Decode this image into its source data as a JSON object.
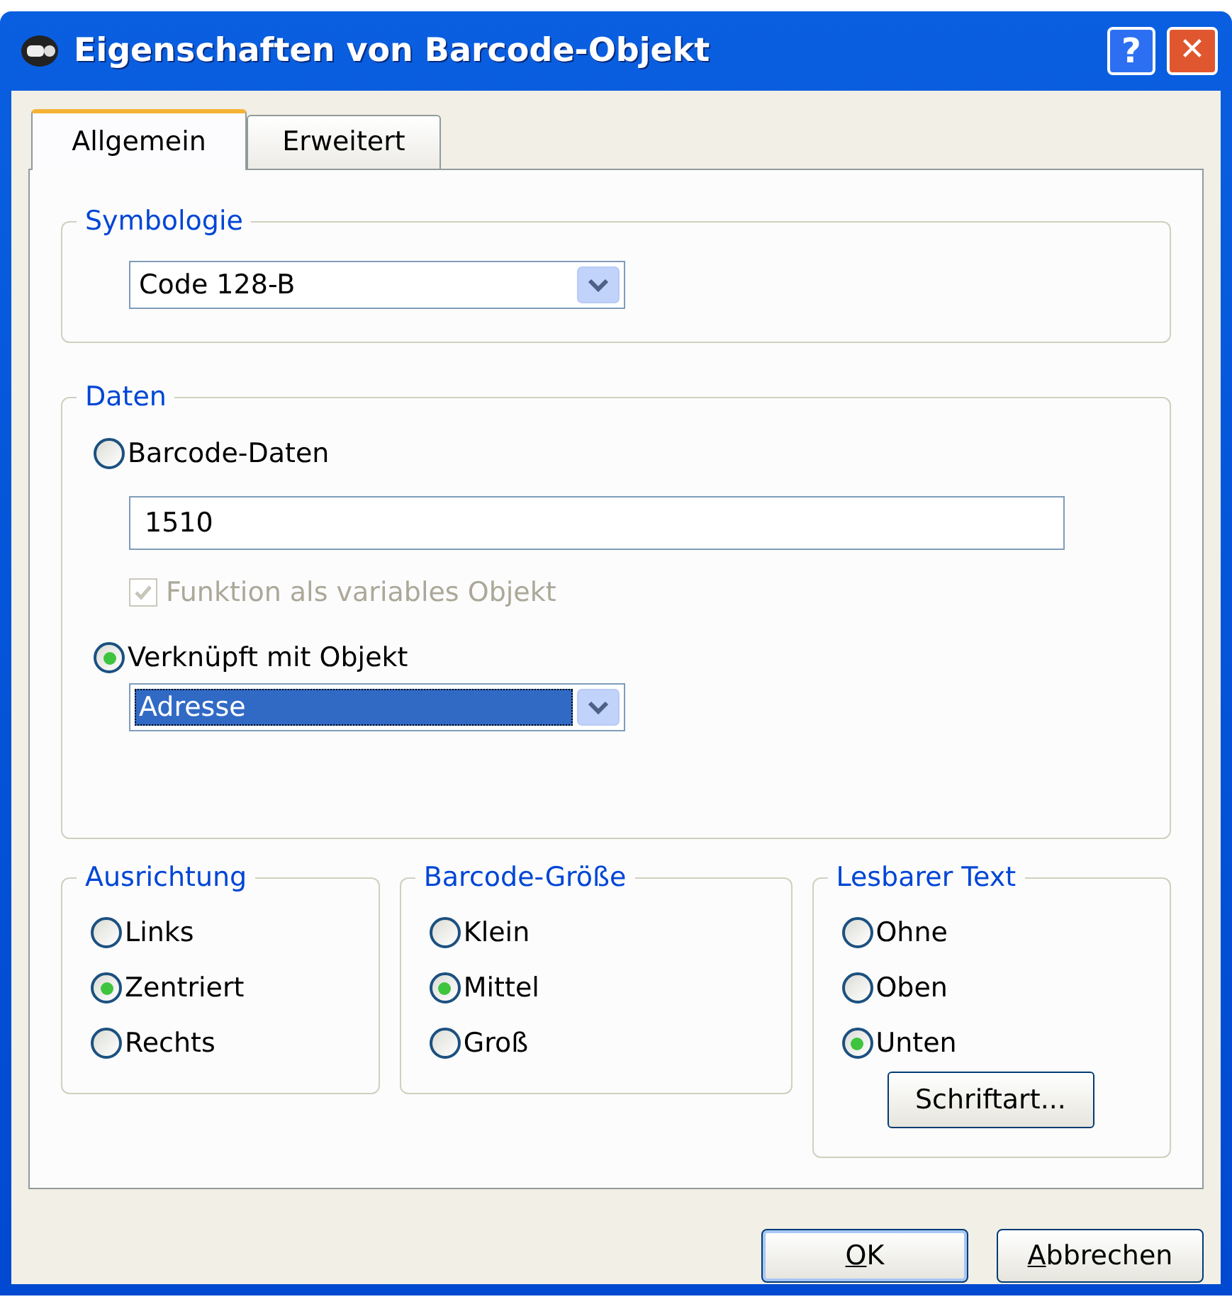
{
  "window": {
    "title": "Eigenschaften von Barcode-Objekt",
    "help_button": "?",
    "close_button": "✕"
  },
  "tabs": [
    {
      "label": "Allgemein",
      "selected": true
    },
    {
      "label": "Erweitert",
      "selected": false
    }
  ],
  "symbologie": {
    "legend": "Symbologie",
    "dropdown": {
      "value": "Code 128-B",
      "focused": false
    }
  },
  "daten": {
    "legend": "Daten",
    "options": [
      {
        "kind": "radio",
        "label": "Barcode-Daten",
        "selected": false
      },
      {
        "kind": "input",
        "value": "1510"
      },
      {
        "kind": "checkbox",
        "label": "Funktion als variables Objekt",
        "checked": true,
        "disabled": true
      },
      {
        "kind": "radio",
        "label": "Verknüpft mit Objekt",
        "selected": true
      },
      {
        "kind": "dropdown",
        "value": "Adresse",
        "focused": true
      }
    ]
  },
  "groups": [
    {
      "legend": "Ausrichtung",
      "options": [
        {
          "label": "Links",
          "selected": false
        },
        {
          "label": "Zentriert",
          "selected": true
        },
        {
          "label": "Rechts",
          "selected": false
        }
      ]
    },
    {
      "legend": "Barcode-Größe",
      "options": [
        {
          "label": "Klein",
          "selected": false
        },
        {
          "label": "Mittel",
          "selected": true
        },
        {
          "label": "Groß",
          "selected": false
        }
      ]
    },
    {
      "legend": "Lesbarer Text",
      "options": [
        {
          "label": "Ohne",
          "selected": false
        },
        {
          "label": "Oben",
          "selected": false
        },
        {
          "label": "Unten",
          "selected": true
        }
      ],
      "button": "Schriftart..."
    }
  ],
  "buttons": [
    {
      "label": "OK",
      "underline_first": true,
      "default": true
    },
    {
      "label": "Abbrechen",
      "underline_first": true,
      "default": false
    }
  ]
}
